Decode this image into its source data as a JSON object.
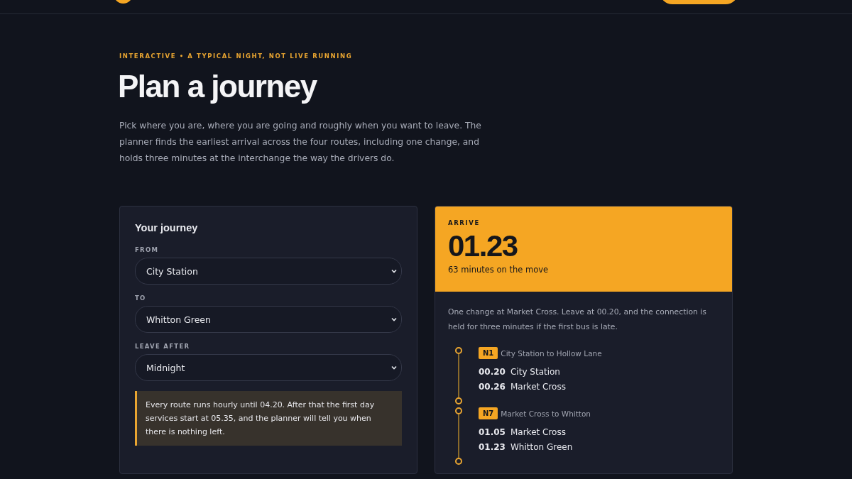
{
  "eyebrow": "INTERACTIVE • A TYPICAL NIGHT, NOT LIVE RUNNING",
  "title": "Plan a journey",
  "intro": "Pick where you are, where you are going and roughly when you want to leave. The planner finds the earliest arrival across the four routes, including one change, and holds three minutes at the interchange the way the drivers do.",
  "form": {
    "title": "Your journey",
    "fields": [
      {
        "label": "FROM",
        "value": "City Station"
      },
      {
        "label": "TO",
        "value": "Whitton Green"
      },
      {
        "label": "LEAVE AFTER",
        "value": "Midnight"
      }
    ],
    "note": "Every route runs hourly until 04.20. After that the first day services start at 05.35, and the planner will tell you when there is nothing left."
  },
  "result": {
    "label": "ARRIVE",
    "time": "01.23",
    "duration": "63 minutes on the move",
    "summary": "One change at Market Cross. Leave at 00.20, and the connection is held for three minutes if the first bus is late.",
    "legs": [
      {
        "route": "N1",
        "description": "City Station to Hollow Lane",
        "stops": [
          {
            "time": "00.20",
            "name": "City Station"
          },
          {
            "time": "00.26",
            "name": "Market Cross"
          }
        ]
      },
      {
        "route": "N7",
        "description": "Market Cross to Whitton",
        "stops": [
          {
            "time": "01.05",
            "name": "Market Cross"
          },
          {
            "time": "01.23",
            "name": "Whitton Green"
          }
        ]
      }
    ]
  }
}
